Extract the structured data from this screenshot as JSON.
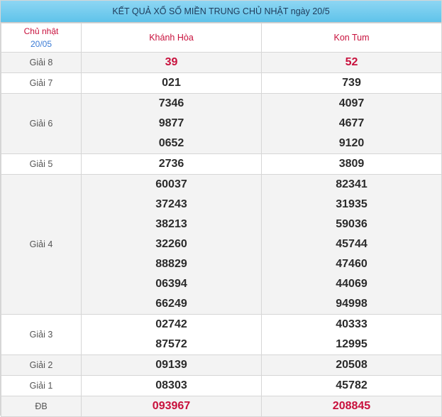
{
  "title": "KẾT QUẢ XỔ SỐ MIỀN TRUNG CHỦ NHẬT ngày 20/5",
  "header": {
    "day": "Chủ nhật",
    "date": "20/05",
    "provinces": [
      "Khánh Hòa",
      "Kon Tum"
    ]
  },
  "rows": [
    {
      "label": "Giải 8",
      "khanh_hoa": [
        "39"
      ],
      "kon_tum": [
        "52"
      ]
    },
    {
      "label": "Giải 7",
      "khanh_hoa": [
        "021"
      ],
      "kon_tum": [
        "739"
      ]
    },
    {
      "label": "Giải 6",
      "khanh_hoa": [
        "7346",
        "9877",
        "0652"
      ],
      "kon_tum": [
        "4097",
        "4677",
        "9120"
      ]
    },
    {
      "label": "Giải 5",
      "khanh_hoa": [
        "2736"
      ],
      "kon_tum": [
        "3809"
      ]
    },
    {
      "label": "Giải 4",
      "khanh_hoa": [
        "60037",
        "37243",
        "38213",
        "32260",
        "88829",
        "06394",
        "66249"
      ],
      "kon_tum": [
        "82341",
        "31935",
        "59036",
        "45744",
        "47460",
        "44069",
        "94998"
      ]
    },
    {
      "label": "Giải 3",
      "khanh_hoa": [
        "02742",
        "87572"
      ],
      "kon_tum": [
        "40333",
        "12995"
      ]
    },
    {
      "label": "Giải 2",
      "khanh_hoa": [
        "09139"
      ],
      "kon_tum": [
        "20508"
      ]
    },
    {
      "label": "Giải 1",
      "khanh_hoa": [
        "08303"
      ],
      "kon_tum": [
        "45782"
      ]
    },
    {
      "label": "ĐB",
      "khanh_hoa": [
        "093967"
      ],
      "kon_tum": [
        "208845"
      ]
    }
  ],
  "colors": {
    "accent_red": "#c8103c",
    "date_blue": "#3a7bd5",
    "title_bg": "#5fc3ea"
  }
}
